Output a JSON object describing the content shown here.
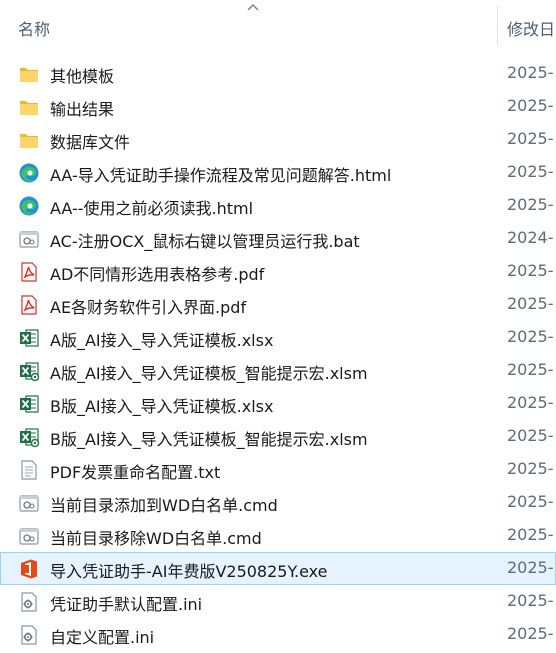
{
  "header": {
    "name_label": "名称",
    "date_label": "修改日"
  },
  "files": [
    {
      "name": "其他模板",
      "date": "2025-",
      "icon": "folder-icon",
      "selected": false
    },
    {
      "name": "输出结果",
      "date": "2025-",
      "icon": "folder-icon",
      "selected": false
    },
    {
      "name": "数据库文件",
      "date": "2025-",
      "icon": "folder-icon",
      "selected": false
    },
    {
      "name": "AA-导入凭证助手操作流程及常见问题解答.html",
      "date": "2025-",
      "icon": "edge-icon",
      "selected": false
    },
    {
      "name": "AA--使用之前必须读我.html",
      "date": "2025-",
      "icon": "edge-icon",
      "selected": false
    },
    {
      "name": "AC-注册OCX_鼠标右键以管理员运行我.bat",
      "date": "2024-",
      "icon": "batch-file-icon",
      "selected": false
    },
    {
      "name": "AD不同情形选用表格参考.pdf",
      "date": "2025-",
      "icon": "pdf-icon",
      "selected": false
    },
    {
      "name": "AE各财务软件引入界面.pdf",
      "date": "2025-",
      "icon": "pdf-icon",
      "selected": false
    },
    {
      "name": "A版_AI接入_导入凭证模板.xlsx",
      "date": "2025-",
      "icon": "excel-icon",
      "selected": false
    },
    {
      "name": "A版_AI接入_导入凭证模板_智能提示宏.xlsm",
      "date": "2025-",
      "icon": "excel-macro-icon",
      "selected": false
    },
    {
      "name": "B版_AI接入_导入凭证模板.xlsx",
      "date": "2025-",
      "icon": "excel-icon",
      "selected": false
    },
    {
      "name": "B版_AI接入_导入凭证模板_智能提示宏.xlsm",
      "date": "2025-",
      "icon": "excel-macro-icon",
      "selected": false
    },
    {
      "name": "PDF发票重命名配置.txt",
      "date": "2025-",
      "icon": "text-file-icon",
      "selected": false
    },
    {
      "name": "当前目录添加到WD白名单.cmd",
      "date": "2025-",
      "icon": "batch-file-icon",
      "selected": false
    },
    {
      "name": "当前目录移除WD白名单.cmd",
      "date": "2025-",
      "icon": "batch-file-icon",
      "selected": false
    },
    {
      "name": "导入凭证助手-AI年费版V250825Y.exe",
      "date": "2025-",
      "icon": "office-app-icon",
      "selected": true
    },
    {
      "name": "凭证助手默认配置.ini",
      "date": "2025-",
      "icon": "config-file-icon",
      "selected": false
    },
    {
      "name": "自定义配置.ini",
      "date": "2025-",
      "icon": "config-file-icon",
      "selected": false
    }
  ]
}
